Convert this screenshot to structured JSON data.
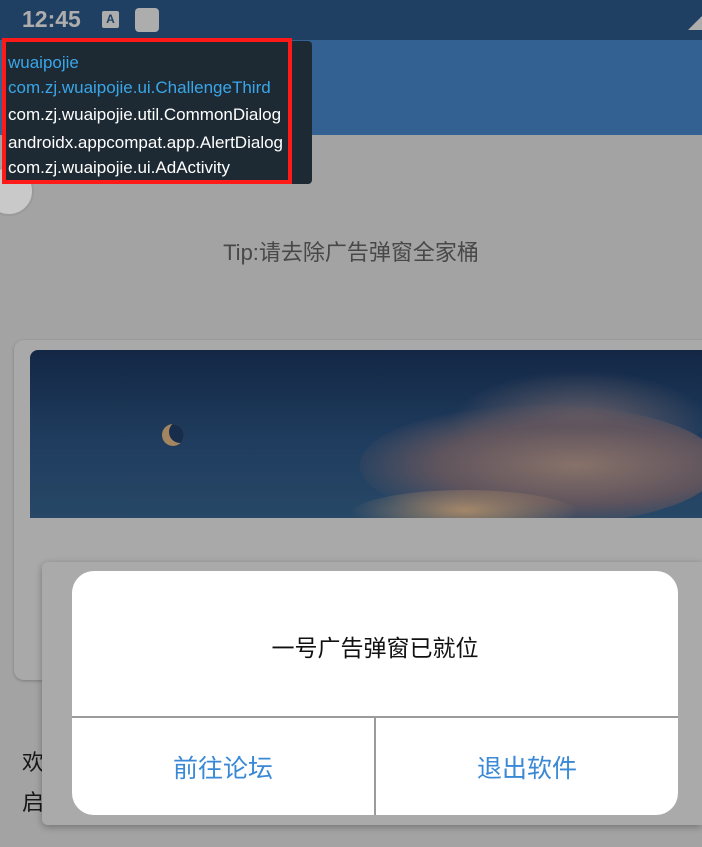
{
  "status_bar": {
    "time": "12:45",
    "notif_icon": "A"
  },
  "app_bar": {
    "title": "wuaipojie"
  },
  "content": {
    "tip": "Tip:请去除广告弹窗全家桶"
  },
  "colors": {
    "accent": "#3a89d6",
    "app_bar": "#4a8fd8",
    "highlight": "#ff1a1a"
  },
  "dialog": {
    "message": "一号广告弹窗已就位",
    "left_button": "前往论坛",
    "right_button": "退出软件"
  },
  "background_text": {
    "line1": "欢",
    "line2": "启"
  },
  "overlay": {
    "lines": [
      "wuaipojie",
      "com.zj.wuaipojie.ui.ChallengeThird",
      "com.zj.wuaipojie.util.CommonDialog",
      "androidx.appcompat.app.AlertDialog",
      "com.zj.wuaipojie.ui.AdActivity"
    ]
  }
}
